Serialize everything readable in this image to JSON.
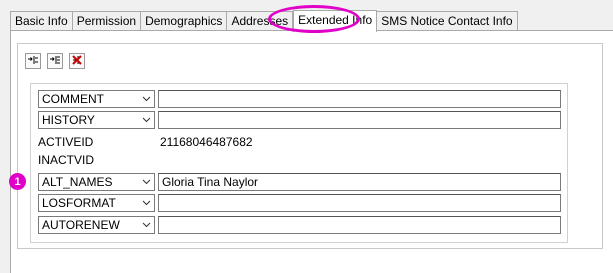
{
  "tabs": [
    {
      "label": "Basic Info",
      "active": false
    },
    {
      "label": "Permission",
      "active": false
    },
    {
      "label": "Demographics",
      "active": false
    },
    {
      "label": "Addresses",
      "active": false
    },
    {
      "label": "Extended Info",
      "active": true
    },
    {
      "label": "SMS Notice Contact Info",
      "active": false
    }
  ],
  "toolbar": {
    "buttons": [
      {
        "icon": "add-link-icon"
      },
      {
        "icon": "edit-link-icon"
      },
      {
        "icon": "delete-icon"
      }
    ]
  },
  "rows": {
    "comment": {
      "name": "COMMENT",
      "value": ""
    },
    "history": {
      "name": "HISTORY",
      "value": ""
    },
    "activeid": {
      "name": "ACTIVEID",
      "value": "21168046487682"
    },
    "inactvid": {
      "name": "INACTVID",
      "value": ""
    },
    "alt_names": {
      "name": "ALT_NAMES",
      "value": "Gloria Tina Naylor"
    },
    "losformat": {
      "name": "LOSFORMAT",
      "value": ""
    },
    "autorenew": {
      "name": "AUTORENEW",
      "value": ""
    }
  },
  "annotation": {
    "badge": "1"
  },
  "colors": {
    "highlight": "#e000c8",
    "delete": "#cc0000"
  }
}
